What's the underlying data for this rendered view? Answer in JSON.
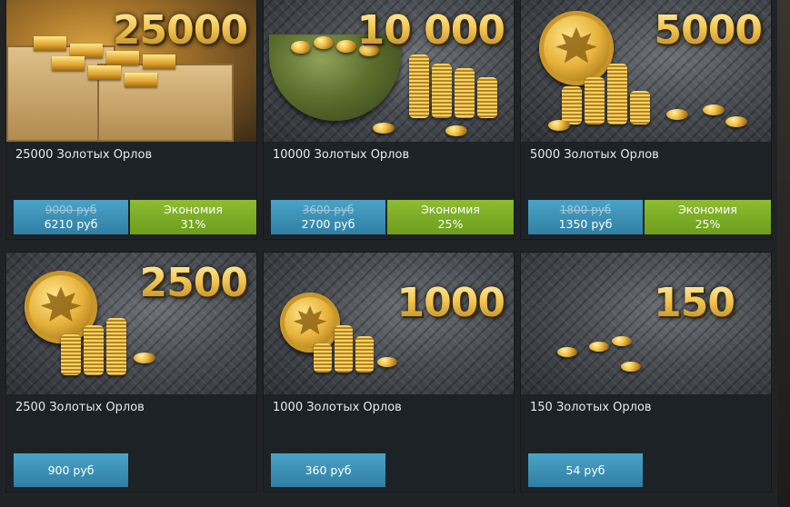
{
  "offers": [
    {
      "amount_badge": "25000",
      "title": "25000 Золотых Орлов",
      "old_price": "9000 руб",
      "price": "6210 руб",
      "saving_label": "Экономия",
      "saving_value": "31%"
    },
    {
      "amount_badge": "10 000",
      "title": "10000 Золотых Орлов",
      "old_price": "3600 руб",
      "price": "2700 руб",
      "saving_label": "Экономия",
      "saving_value": "25%"
    },
    {
      "amount_badge": "5000",
      "title": "5000 Золотых Орлов",
      "old_price": "1800 руб",
      "price": "1350 руб",
      "saving_label": "Экономия",
      "saving_value": "25%"
    },
    {
      "amount_badge": "2500",
      "title": "2500 Золотых Орлов",
      "price": "900 руб"
    },
    {
      "amount_badge": "1000",
      "title": "1000 Золотых Орлов",
      "price": "360 руб"
    },
    {
      "amount_badge": "150",
      "title": "150 Золотых Орлов",
      "price": "54 руб"
    }
  ],
  "colors": {
    "price_button": "#3a90b5",
    "saving_box": "#7aab24",
    "gold_text": "#f1c44c",
    "card_bg": "#1d2227"
  },
  "icons": [
    "eagle-coin-icon"
  ]
}
